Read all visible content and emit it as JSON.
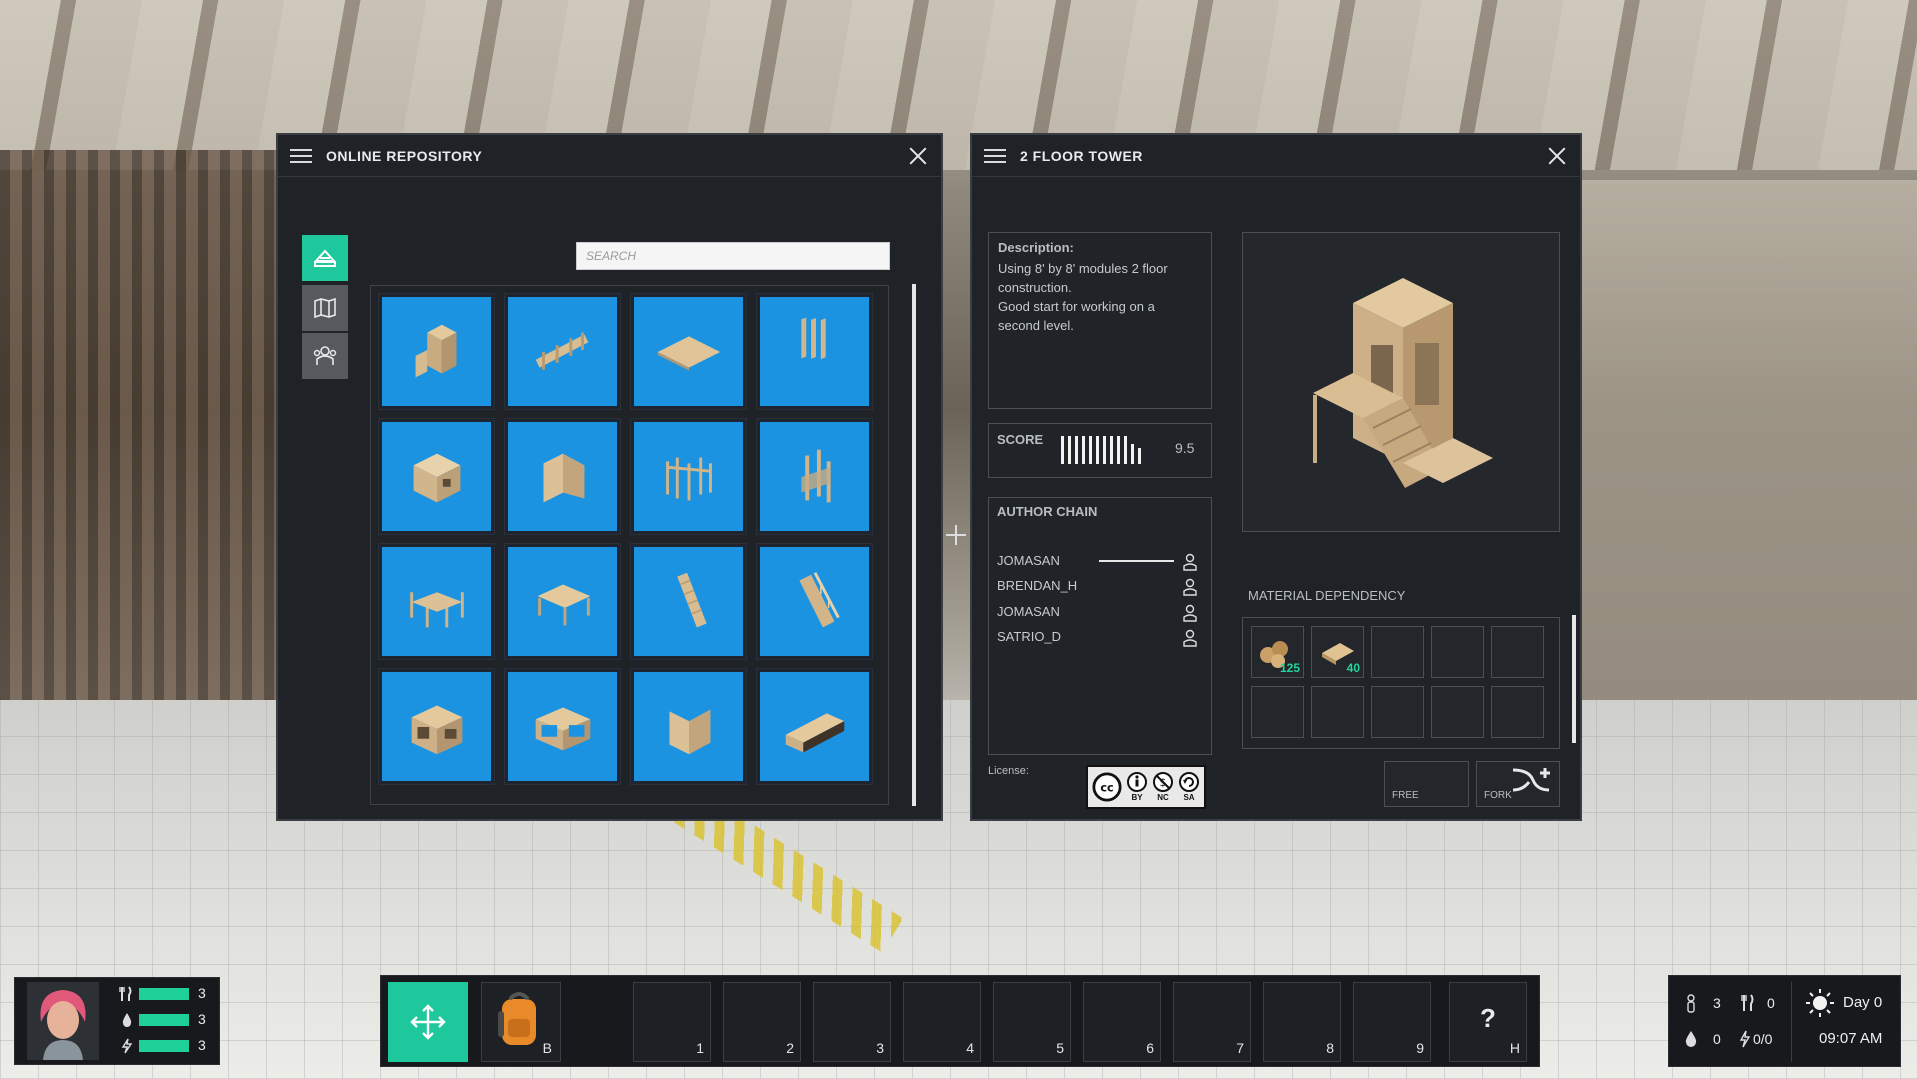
{
  "repository": {
    "title": "ONLINE REPOSITORY",
    "search_placeholder": "SEARCH",
    "side_tabs": [
      "repository-icon",
      "map-icon",
      "community-icon"
    ],
    "tiles": [
      "tower-model",
      "fence-model",
      "floor-slab-model",
      "rail-model",
      "box-module-model",
      "corner-wall-model",
      "frame-cluster-model",
      "pillar-frame-model",
      "shelf-frame-model",
      "table-model",
      "stair-model",
      "stair-rail-model",
      "house-module-model",
      "open-house-model",
      "corner-panel-model",
      "long-container-model"
    ]
  },
  "detail": {
    "title": "2 FLOOR TOWER",
    "description_label": "Description:",
    "description_lines": [
      "Using 8' by 8' modules 2 floor",
      "construction.",
      "Good start for working on a",
      "second level."
    ],
    "score_label": "SCORE",
    "score_value": "9.5",
    "author_chain_label": "AUTHOR CHAIN",
    "authors": [
      "JOMASAN",
      "BRENDAN_H",
      "JOMASAN",
      "SATRIO_D"
    ],
    "material_label": "MATERIAL DEPENDENCY",
    "materials": [
      {
        "icon": "logs-icon",
        "count": "125"
      },
      {
        "icon": "planks-icon",
        "count": "40"
      }
    ],
    "license_label": "License:",
    "license_badge": [
      "BY",
      "NC",
      "SA"
    ],
    "free_label": "FREE",
    "fork_label": "FORK"
  },
  "hud": {
    "stats": [
      {
        "icon": "food-icon",
        "value": "3",
        "fill": 1.0
      },
      {
        "icon": "water-icon",
        "value": "3",
        "fill": 1.0
      },
      {
        "icon": "energy-icon",
        "value": "3",
        "fill": 1.0
      }
    ],
    "hotbar": {
      "backpack_key": "B",
      "slots": [
        "1",
        "2",
        "3",
        "4",
        "5",
        "6",
        "7",
        "8",
        "9"
      ],
      "help_symbol": "?",
      "help_key": "H"
    },
    "status": {
      "people": "3",
      "food": "0",
      "water": "0",
      "power": "0/0",
      "day": "Day 0",
      "time": "09:07 AM"
    }
  }
}
